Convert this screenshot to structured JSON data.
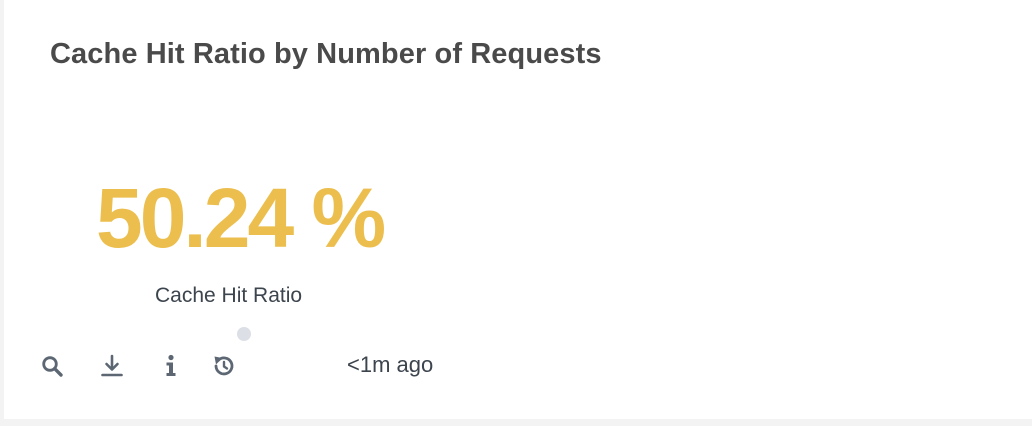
{
  "panel": {
    "title": "Cache Hit Ratio by Number of Requests",
    "single_value": "50.24 %",
    "value_label": "Cache Hit Ratio",
    "value_color": "#ecbe4e",
    "pager": {
      "current": 1,
      "total": 1
    }
  },
  "toolbar": {
    "icons": [
      "search-icon",
      "export-icon",
      "info-icon",
      "refresh-icon"
    ],
    "icon_color": "#5c6773",
    "refresh_time": "<1m ago"
  }
}
